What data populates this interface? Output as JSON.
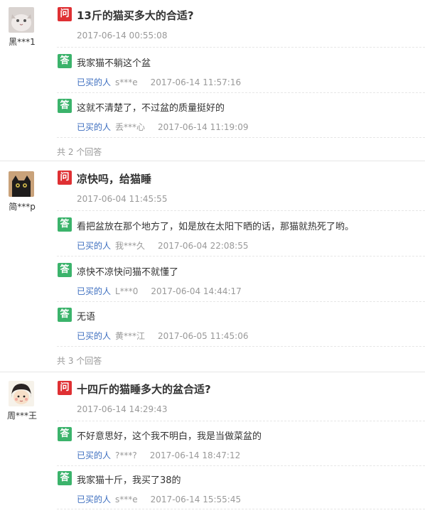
{
  "questions": [
    {
      "user": "黑***1",
      "badge": "问",
      "question": "13斤的猫买多大的合适?",
      "date": "2017-06-14 00:55:08",
      "answers": [
        {
          "badge": "答",
          "text": "我家猫不躺这个盆",
          "buyer_label": "已买的人",
          "user": "s***e",
          "date": "2017-06-14 11:57:16"
        },
        {
          "badge": "答",
          "text": "这就不清楚了，不过盆的质量挺好的",
          "buyer_label": "已买的人",
          "user": "丢***心",
          "date": "2017-06-14 11:19:09"
        }
      ],
      "total": "共 2 个回答"
    },
    {
      "user": "简***p",
      "badge": "问",
      "question": "凉快吗，给猫睡",
      "date": "2017-06-04 11:45:55",
      "answers": [
        {
          "badge": "答",
          "text": "看把盆放在那个地方了，如是放在太阳下晒的话，那猫就热死了哟。",
          "buyer_label": "已买的人",
          "user": "我***久",
          "date": "2017-06-04 22:08:55"
        },
        {
          "badge": "答",
          "text": "凉快不凉快问猫不就懂了",
          "buyer_label": "已买的人",
          "user": "L***0",
          "date": "2017-06-04 14:44:17"
        },
        {
          "badge": "答",
          "text": "无语",
          "buyer_label": "已买的人",
          "user": "黄***江",
          "date": "2017-06-05 11:45:06"
        }
      ],
      "total": "共 3 个回答"
    },
    {
      "user": "周***王",
      "badge": "问",
      "question": "十四斤的猫睡多大的盆合适?",
      "date": "2017-06-14 14:29:43",
      "answers": [
        {
          "badge": "答",
          "text": "不好意思好，这个我不明白，我是当做菜盆的",
          "buyer_label": "已买的人",
          "user": "?***?",
          "date": "2017-06-14 18:47:12"
        },
        {
          "badge": "答",
          "text": "我家猫十斤，我买了38的",
          "buyer_label": "已买的人",
          "user": "s***e",
          "date": "2017-06-14 15:55:45"
        }
      ]
    }
  ],
  "colors": {
    "question_badge": "#df3033",
    "answer_badge": "#3bb36b",
    "buyer_link": "#3b6dbf",
    "muted": "#999999"
  }
}
